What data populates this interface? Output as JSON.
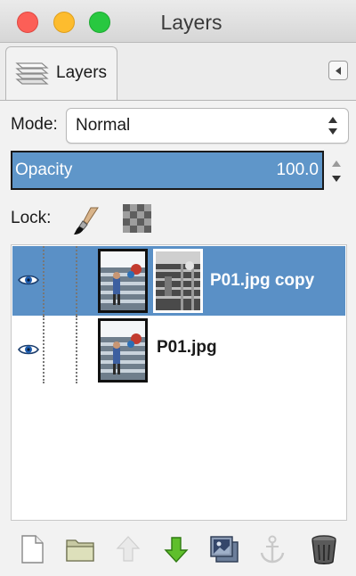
{
  "window": {
    "title": "Layers"
  },
  "tab": {
    "label": "Layers",
    "icon": "layers-icon",
    "menu_icon": "tab-menu-icon"
  },
  "mode": {
    "label": "Mode:",
    "value": "Normal"
  },
  "opacity": {
    "label": "Opacity",
    "value": "100.0"
  },
  "lock": {
    "label": "Lock:",
    "icons": [
      "paintbrush-lock-icon",
      "alpha-lock-icon"
    ]
  },
  "layers": [
    {
      "name": "P01.jpg copy",
      "visible": true,
      "selected": true,
      "has_mask": true
    },
    {
      "name": "P01.jpg",
      "visible": true,
      "selected": false,
      "has_mask": false
    }
  ],
  "toolbar": {
    "buttons": [
      "new-layer-icon",
      "new-layer-group-icon",
      "raise-layer-icon",
      "lower-layer-icon",
      "duplicate-layer-icon",
      "anchor-layer-icon",
      "delete-layer-icon"
    ]
  },
  "colors": {
    "selection": "#5a90c6",
    "opacity_fill": "#5f96c9",
    "lower_arrow": "#5fbf2c"
  }
}
